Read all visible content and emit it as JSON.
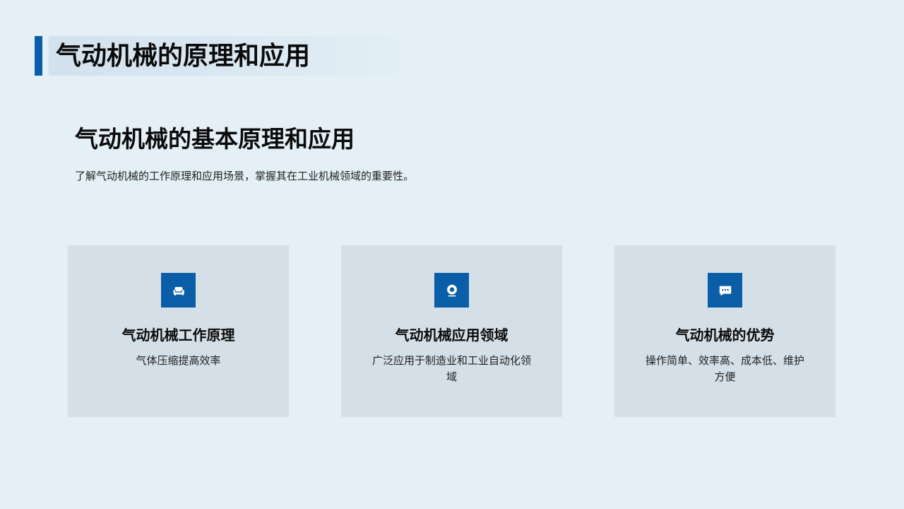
{
  "header": {
    "title": "气动机械的原理和应用"
  },
  "section": {
    "heading": "气动机械的基本原理和应用",
    "description": "了解气动机械的工作原理和应用场景，掌握其在工业机械领域的重要性。"
  },
  "cards": [
    {
      "icon": "couch-icon",
      "title": "气动机械工作原理",
      "text": "气体压缩提高效率"
    },
    {
      "icon": "webcam-icon",
      "title": "气动机械应用领域",
      "text": "广泛应用于制造业和工业自动化领域"
    },
    {
      "icon": "chat-bubble-icon",
      "title": "气动机械的优势",
      "text": "操作简单、效率高、成本低、维护方便"
    }
  ],
  "colors": {
    "background": "#e4eff6",
    "accent": "#0a5ea8",
    "card_background": "#d5dfe7"
  }
}
